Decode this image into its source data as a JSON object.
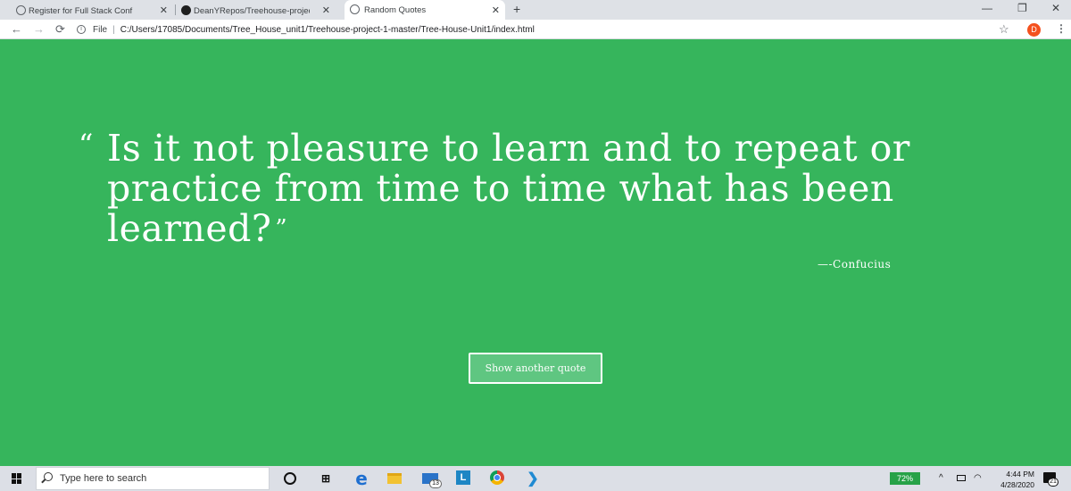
{
  "browser": {
    "tabs": [
      {
        "title": "Register for Full Stack Conf",
        "icon": "globe-icon"
      },
      {
        "title": "DeanYRepos/Treehouse-project-",
        "icon": "github-icon"
      },
      {
        "title": "Random Quotes",
        "icon": "globe-icon",
        "active": true
      }
    ],
    "close_glyph": "✕",
    "new_tab_glyph": "+",
    "window_controls": {
      "minimize": "—",
      "maximize": "❐",
      "close": "✕"
    },
    "nav": {
      "back": "←",
      "forward": "→",
      "reload": "⟳"
    },
    "address": {
      "info_glyph": "i",
      "scheme_label": "File",
      "separator": "|",
      "url": "C:/Users/17085/Documents/Tree_House_unit1/Treehouse-project-1-master/Tree-House-Unit1/index.html"
    },
    "bookmark_glyph": "☆",
    "profile_initial": "D",
    "menu_glyph": "⋮"
  },
  "page": {
    "background_color": "#36b55c",
    "quote": {
      "open_mark": "“",
      "text": "Is it not pleasure to learn and to repeat or practice from time to time what has been learned?",
      "close_mark": "”"
    },
    "source": "—-Confucius",
    "button_label": "Show another quote"
  },
  "taskbar": {
    "search_placeholder": "Type here to search",
    "mail_badge": "13",
    "launcher_letter": "L",
    "battery": "72%",
    "tray": {
      "chevron": "^",
      "wifi": "◠"
    },
    "clock": {
      "time": "4:44 PM",
      "date": "4/28/2020"
    },
    "notification_count": "21"
  }
}
